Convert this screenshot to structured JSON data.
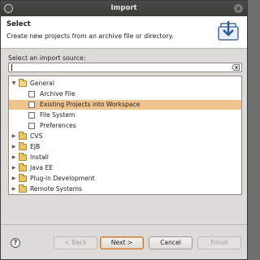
{
  "window": {
    "title": "Import",
    "close_glyph": "×"
  },
  "header": {
    "title": "Select",
    "description": "Create new projects from an archive file or directory."
  },
  "source": {
    "label": "Select an import source:",
    "filter_value": "",
    "filter_placeholder": ""
  },
  "tree": {
    "items": [
      {
        "label": "General",
        "level": 0,
        "expanded": true,
        "icon": "folder-open-icon"
      },
      {
        "label": "Archive File",
        "level": 1,
        "icon": "archive-file-icon"
      },
      {
        "label": "Existing Projects into Workspace",
        "level": 1,
        "selected": true,
        "icon": "existing-projects-icon"
      },
      {
        "label": "File System",
        "level": 1,
        "icon": "file-system-icon"
      },
      {
        "label": "Preferences",
        "level": 1,
        "icon": "preferences-icon"
      },
      {
        "label": "CVS",
        "level": 0,
        "expanded": false,
        "icon": "folder-icon"
      },
      {
        "label": "EJB",
        "level": 0,
        "expanded": false,
        "icon": "folder-icon"
      },
      {
        "label": "Install",
        "level": 0,
        "expanded": false,
        "icon": "folder-icon"
      },
      {
        "label": "Java EE",
        "level": 0,
        "expanded": false,
        "icon": "folder-icon"
      },
      {
        "label": "Plug-in Development",
        "level": 0,
        "expanded": false,
        "icon": "folder-icon"
      },
      {
        "label": "Remote Systems",
        "level": 0,
        "expanded": false,
        "icon": "folder-icon"
      }
    ]
  },
  "buttons": {
    "help": "?",
    "back": "< Back",
    "next": "Next >",
    "cancel": "Cancel",
    "finish": "Finish"
  },
  "colors": {
    "selection": "#f0c48e",
    "titlebar": "#3b3b38",
    "dialog_bg": "#dcdbd7"
  }
}
